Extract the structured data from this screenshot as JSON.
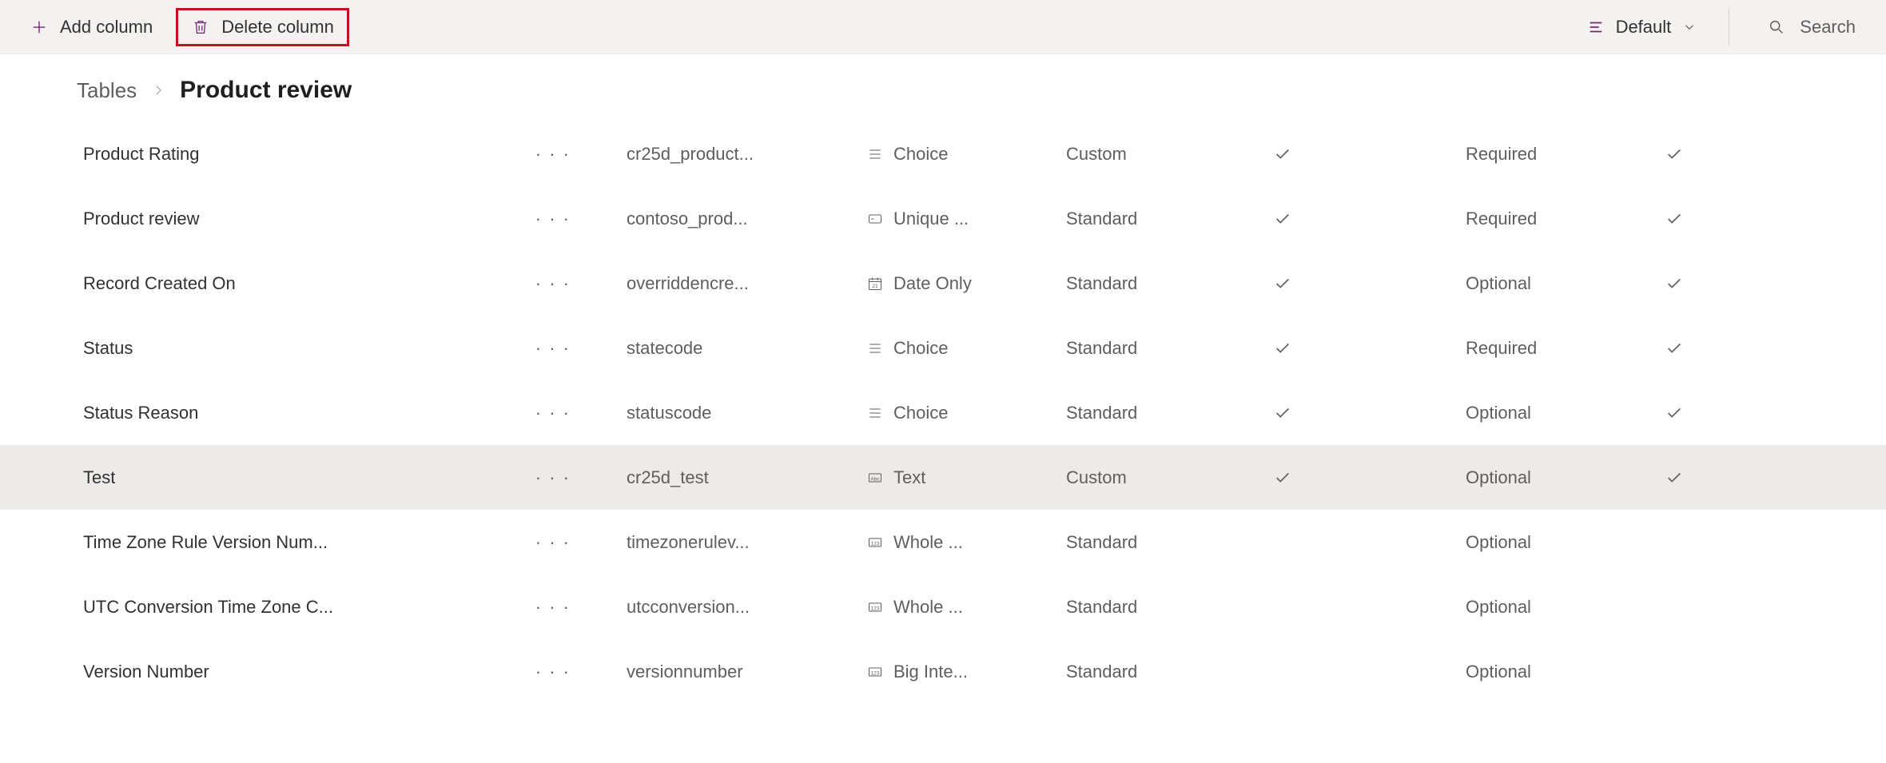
{
  "toolbar": {
    "add_column": "Add column",
    "delete_column": "Delete column",
    "view_label": "Default",
    "search_label": "Search"
  },
  "breadcrumb": {
    "parent": "Tables",
    "current": "Product review"
  },
  "columns": [
    {
      "display": "Product Rating",
      "logical": "cr25d_product...",
      "type": "Choice",
      "type_icon": "choice",
      "category": "Custom",
      "customizable": true,
      "required": "Required",
      "searchable": true
    },
    {
      "display": "Product review",
      "logical": "contoso_prod...",
      "type": "Unique ...",
      "type_icon": "key",
      "category": "Standard",
      "customizable": true,
      "required": "Required",
      "searchable": true
    },
    {
      "display": "Record Created On",
      "logical": "overriddencre...",
      "type": "Date Only",
      "type_icon": "date",
      "category": "Standard",
      "customizable": true,
      "required": "Optional",
      "searchable": true
    },
    {
      "display": "Status",
      "logical": "statecode",
      "type": "Choice",
      "type_icon": "choice",
      "category": "Standard",
      "customizable": true,
      "required": "Required",
      "searchable": true
    },
    {
      "display": "Status Reason",
      "logical": "statuscode",
      "type": "Choice",
      "type_icon": "choice",
      "category": "Standard",
      "customizable": true,
      "required": "Optional",
      "searchable": true
    },
    {
      "display": "Test",
      "logical": "cr25d_test",
      "type": "Text",
      "type_icon": "text",
      "category": "Custom",
      "customizable": true,
      "required": "Optional",
      "searchable": true,
      "selected": true
    },
    {
      "display": "Time Zone Rule Version Num...",
      "logical": "timezonerulev...",
      "type": "Whole ...",
      "type_icon": "number",
      "category": "Standard",
      "customizable": false,
      "required": "Optional",
      "searchable": false
    },
    {
      "display": "UTC Conversion Time Zone C...",
      "logical": "utcconversion...",
      "type": "Whole ...",
      "type_icon": "number",
      "category": "Standard",
      "customizable": false,
      "required": "Optional",
      "searchable": false
    },
    {
      "display": "Version Number",
      "logical": "versionnumber",
      "type": "Big Inte...",
      "type_icon": "number",
      "category": "Standard",
      "customizable": false,
      "required": "Optional",
      "searchable": false
    }
  ]
}
